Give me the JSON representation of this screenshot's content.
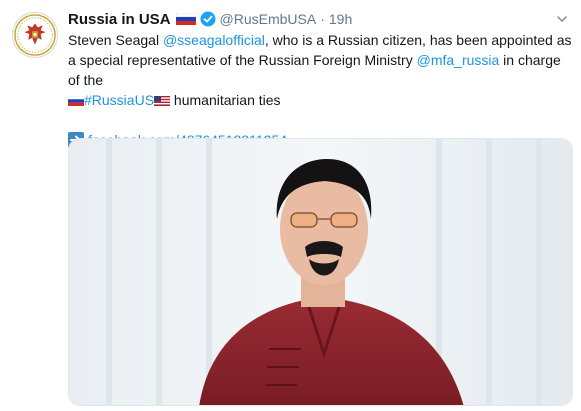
{
  "account": {
    "name": "Russia in USA",
    "handle": "@RusEmbUSA",
    "separator": "·",
    "time": "19h"
  },
  "tweet": {
    "part1": "Steven Seagal ",
    "mention1": "@sseagalofficial",
    "part2": ", who is a Russian citizen, has been appointed as a special representative of the Russian Foreign Ministry ",
    "mention2": "@mfa_russia",
    "part3": " in charge of the ",
    "hashtag": "#RussiaUS",
    "part4": " humanitarian ties",
    "link": "facebook.com/48764518811254..."
  },
  "icons": {
    "verified": "verified-badge-icon",
    "flag_russia": "russia-flag-icon",
    "flag_usa": "usa-flag-icon",
    "arrow": "right-arrow-icon",
    "more": "chevron-down-icon",
    "avatar": "russian-coat-of-arms-icon"
  },
  "colors": {
    "link": "#1b95e0",
    "text": "#14171a",
    "muted": "#657786",
    "verified": "#1da1f2",
    "arrow_box": "#3b88c3"
  }
}
